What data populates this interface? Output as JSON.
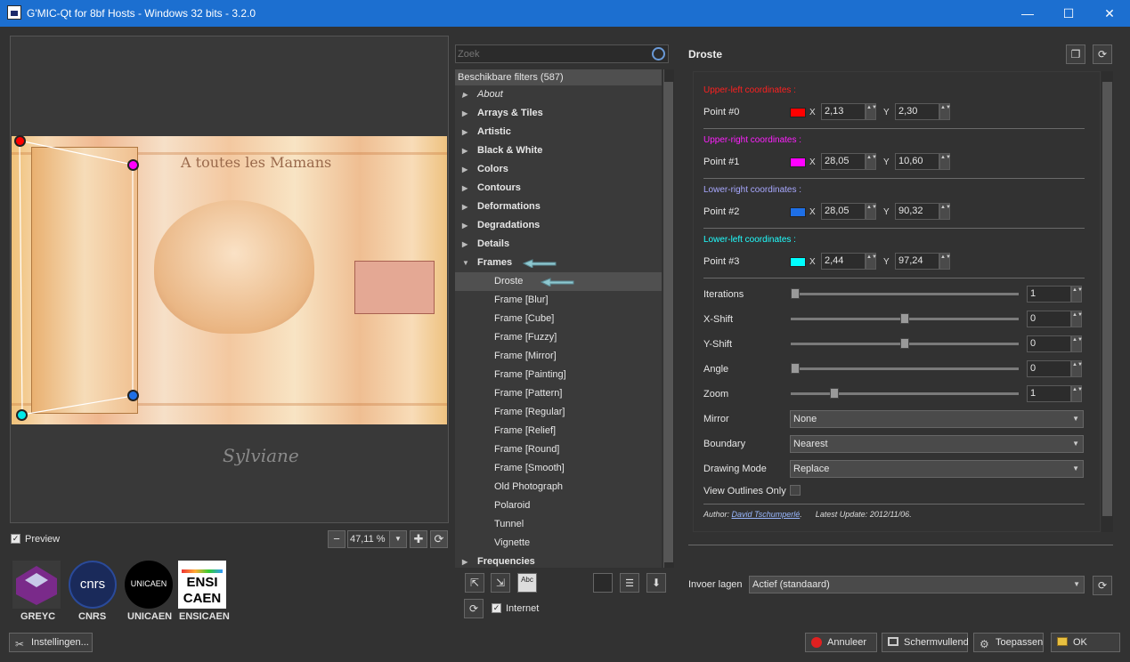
{
  "window": {
    "title": "G'MIC-Qt for 8bf Hosts - Windows 32 bits - 3.2.0",
    "minimize": "—",
    "maximize": "☐",
    "close": "✕"
  },
  "preview": {
    "image_title": "A toutes les Mamans",
    "signature": "Sylviane",
    "preview_label": "Preview",
    "zoom": "47,11 %",
    "zoom_minus": "−",
    "zoom_plus": "✚",
    "refresh": "⟳",
    "point_colors": [
      "#ff0000",
      "#ff00ff",
      "#1e6fe6",
      "#00e8e8"
    ]
  },
  "logos": [
    "GREYC",
    "CNRS",
    "UNICAEN",
    "ENSICAEN"
  ],
  "logo_text": {
    "cnrs": "cnrs",
    "unicaen": "UNICAEN",
    "ensi": "ENSI",
    "caen": "CAEN"
  },
  "settings_button": "Instellingen...",
  "filters": {
    "search_placeholder": "Zoek",
    "header": "Beschikbare filters (587)",
    "items": [
      {
        "label": "About",
        "kind": "it",
        "arrow": "▶"
      },
      {
        "label": "Arrays & Tiles",
        "kind": "cat",
        "arrow": "▶"
      },
      {
        "label": "Artistic",
        "kind": "cat",
        "arrow": "▶"
      },
      {
        "label": "Black & White",
        "kind": "cat",
        "arrow": "▶"
      },
      {
        "label": "Colors",
        "kind": "cat",
        "arrow": "▶"
      },
      {
        "label": "Contours",
        "kind": "cat",
        "arrow": "▶"
      },
      {
        "label": "Deformations",
        "kind": "cat",
        "arrow": "▶"
      },
      {
        "label": "Degradations",
        "kind": "cat",
        "arrow": "▶"
      },
      {
        "label": "Details",
        "kind": "cat",
        "arrow": "▶"
      },
      {
        "label": "Frames",
        "kind": "cat",
        "arrow": "▼"
      },
      {
        "label": "Droste",
        "kind": "sub",
        "selected": true
      },
      {
        "label": "Frame [Blur]",
        "kind": "sub"
      },
      {
        "label": "Frame [Cube]",
        "kind": "sub"
      },
      {
        "label": "Frame [Fuzzy]",
        "kind": "sub"
      },
      {
        "label": "Frame [Mirror]",
        "kind": "sub"
      },
      {
        "label": "Frame [Painting]",
        "kind": "sub"
      },
      {
        "label": "Frame [Pattern]",
        "kind": "sub"
      },
      {
        "label": "Frame [Regular]",
        "kind": "sub"
      },
      {
        "label": "Frame [Relief]",
        "kind": "sub"
      },
      {
        "label": "Frame [Round]",
        "kind": "sub"
      },
      {
        "label": "Frame [Smooth]",
        "kind": "sub"
      },
      {
        "label": "Old Photograph",
        "kind": "sub"
      },
      {
        "label": "Polaroid",
        "kind": "sub"
      },
      {
        "label": "Tunnel",
        "kind": "sub"
      },
      {
        "label": "Vignette",
        "kind": "sub"
      },
      {
        "label": "Frequencies",
        "kind": "cat",
        "arrow": "▶"
      }
    ],
    "internet_label": "Internet",
    "bottom_button_glyphs": {
      "add": "⇱",
      "remove": "⇲",
      "rename": "Abc",
      "down": "⬇",
      "refresh": "⟳"
    }
  },
  "params": {
    "filter_name": "Droste",
    "top_icons": {
      "copy": "❐",
      "refresh": "⟳"
    },
    "x_label": "X",
    "y_label": "Y",
    "spin_glyph": "▲▼",
    "dd_glyph": "▼",
    "points": [
      {
        "header": "Upper-left coordinates :",
        "color": "#ff2020",
        "label": "Point #0",
        "swatch": "#ff0000",
        "x": "2,13",
        "y": "2,30"
      },
      {
        "header": "Upper-right coordinates :",
        "color": "#ff20ff",
        "label": "Point #1",
        "swatch": "#ff00ff",
        "x": "28,05",
        "y": "10,60"
      },
      {
        "header": "Lower-right coordinates :",
        "color": "#a8a8ff",
        "label": "Point #2",
        "swatch": "#1e6fe6",
        "x": "28,05",
        "y": "90,32"
      },
      {
        "header": "Lower-left coordinates :",
        "color": "#20ffff",
        "label": "Point #3",
        "swatch": "#00ffff",
        "x": "2,44",
        "y": "97,24"
      }
    ],
    "sliders": [
      {
        "label": "Iterations",
        "value": "1",
        "level": 0.0
      },
      {
        "label": "X-Shift",
        "value": "0",
        "level": 0.5
      },
      {
        "label": "Y-Shift",
        "value": "0",
        "level": 0.5
      },
      {
        "label": "Angle",
        "value": "0",
        "level": 0.0
      },
      {
        "label": "Zoom",
        "value": "1",
        "level": 0.18
      }
    ],
    "combos": [
      {
        "label": "Mirror",
        "value": "None"
      },
      {
        "label": "Boundary",
        "value": "Nearest"
      },
      {
        "label": "Drawing Mode",
        "value": "Replace"
      }
    ],
    "outlines_label": "View Outlines Only",
    "author_prefix": "Author: ",
    "author": "David Tschumperlé",
    "author_suffix": ".",
    "update_prefix": "Latest Update: ",
    "update": "2012/11/06",
    "update_suffix": "."
  },
  "input_layers": {
    "label": "Invoer lagen",
    "value": "Actief (standaard)"
  },
  "footer": {
    "cancel": "Annuleer",
    "fullscreen": "Schermvullend",
    "apply": "Toepassen",
    "ok": "OK"
  }
}
